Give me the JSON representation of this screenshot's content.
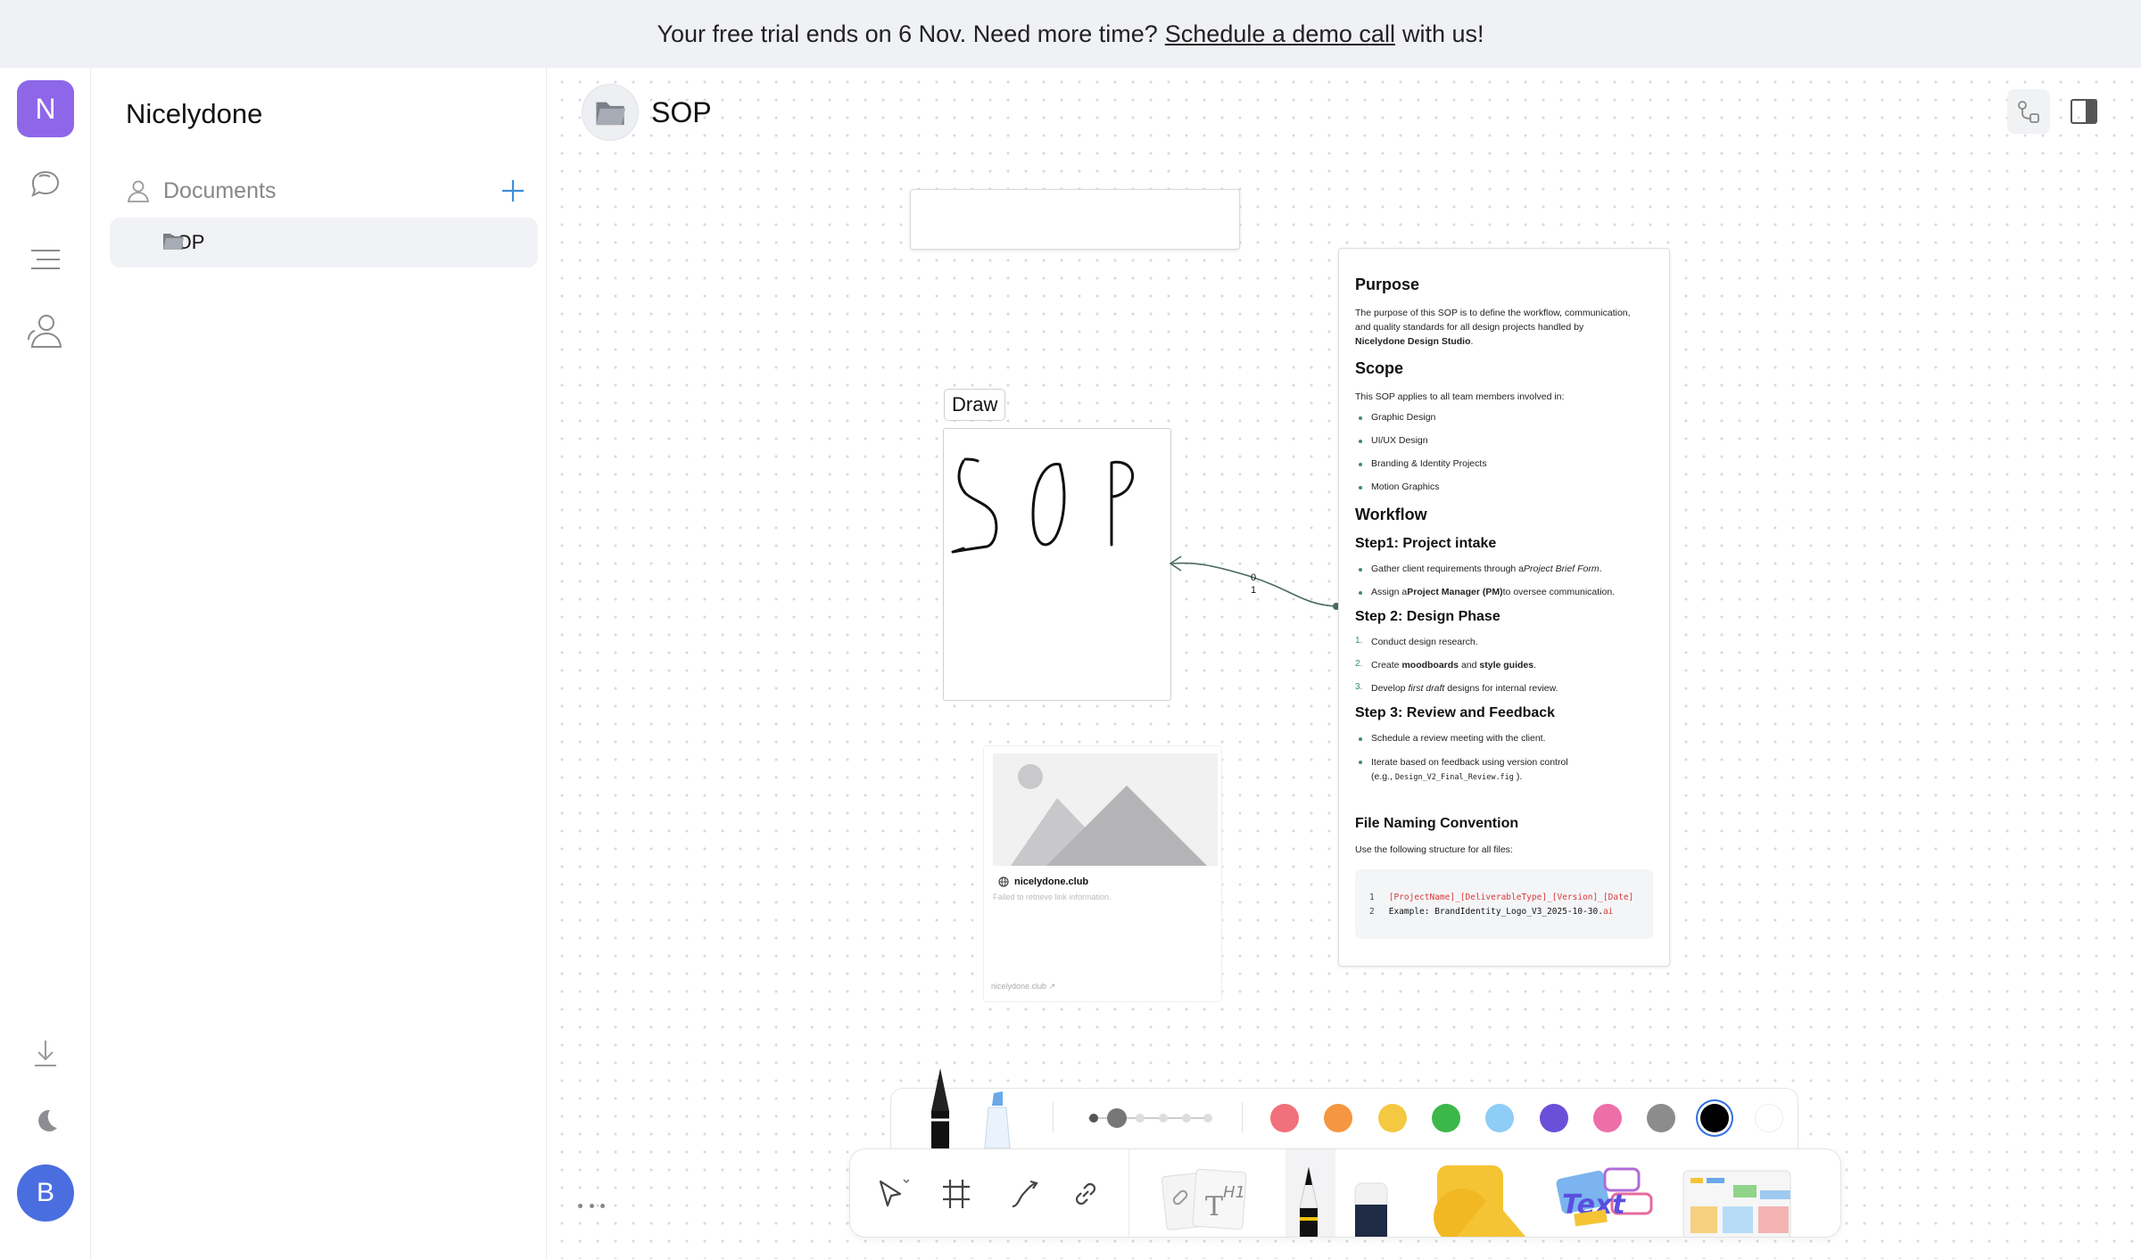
{
  "banner": {
    "prefix": "Your free trial ends on 6 Nov. Need more time?",
    "link": "Schedule a demo call",
    "suffix": "with us!"
  },
  "rail": {
    "workspace_initial": "N",
    "user_initial": "B",
    "icons": [
      "chat-icon",
      "menu-icon",
      "team-icon",
      "download-icon",
      "moon-icon"
    ]
  },
  "sidebar": {
    "workspace_name": "Nicelydone",
    "section_label": "Documents",
    "items": [
      {
        "label": "SOP"
      }
    ]
  },
  "document": {
    "title": "SOP"
  },
  "canvas": {
    "draw_label": "Draw",
    "connector_labels": [
      "0",
      "1"
    ],
    "link_card": {
      "domain": "nicelydone.club",
      "error": "Failed to retrieve link information.",
      "footer": "nicelydone.club"
    },
    "doc_card": {
      "purpose_heading": "Purpose",
      "purpose_text_1": "The purpose of this SOP is to define the workflow, communication,",
      "purpose_text_2": "and quality standards for all design projects handled by",
      "purpose_text_bold": "Nicelydone Design Studio",
      "purpose_text_end": ".",
      "scope_heading": "Scope",
      "scope_intro": "This SOP applies to all team members involved in:",
      "scope_items": [
        "Graphic Design",
        "UI/UX Design",
        "Branding & Identity Projects",
        "Motion Graphics"
      ],
      "workflow_heading": "Workflow",
      "step1_heading": "Step1: Project intake",
      "step1_item1_a": "Gather client requirements through a",
      "step1_item1_b": "Project Brief Form",
      "step1_item1_c": ".",
      "step1_item2_a": "Assign a",
      "step1_item2_b": "Project Manager (PM)",
      "step1_item2_c": "to oversee communication.",
      "step2_heading": "Step 2: Design Phase",
      "step2_item1": "Conduct design research.",
      "step2_item2_a": "Create",
      "step2_item2_b": "moodboards",
      "step2_item2_c": "and",
      "step2_item2_d": "style guides",
      "step2_item2_e": ".",
      "step2_item3_a": "Develop",
      "step2_item3_b": "first draft",
      "step2_item3_c": "designs for internal review.",
      "step3_heading": "Step 3: Review and Feedback",
      "step3_item1": "Schedule a review meeting with the client.",
      "step3_item2_a": "Iterate based on feedback using version control",
      "step3_item2_b": "(e.g.,",
      "step3_item2_code": "Design_V2_Final_Review.fig",
      "step3_item2_c": ").",
      "naming_heading": "File Naming Convention",
      "naming_intro": "Use the following structure for all files:",
      "code_line1_no": "1",
      "code_line1": "[ProjectName]_[DeliverableType]_[Version]_[Date]",
      "code_line2_no": "2",
      "code_line2_a": "Example: BrandIdentity_Logo_V3_2025-10-30.",
      "code_line2_b": "ai"
    }
  },
  "toolbar": {
    "stroke_sizes": 6,
    "selected_stroke": 1,
    "colors": [
      "#f2707b",
      "#f59640",
      "#f5c842",
      "#3cb84a",
      "#8ecdf5",
      "#6a4fd9",
      "#ec6fa8",
      "#8c8c8c",
      "#000000",
      "#ffffff"
    ],
    "selected_color": "#000000",
    "tools": [
      "pointer-tool",
      "frame-tool",
      "connector-tool",
      "link-tool",
      "note-tool",
      "pen-tool",
      "eraser-tool",
      "shape-tool",
      "text-tool",
      "template-tool"
    ]
  }
}
